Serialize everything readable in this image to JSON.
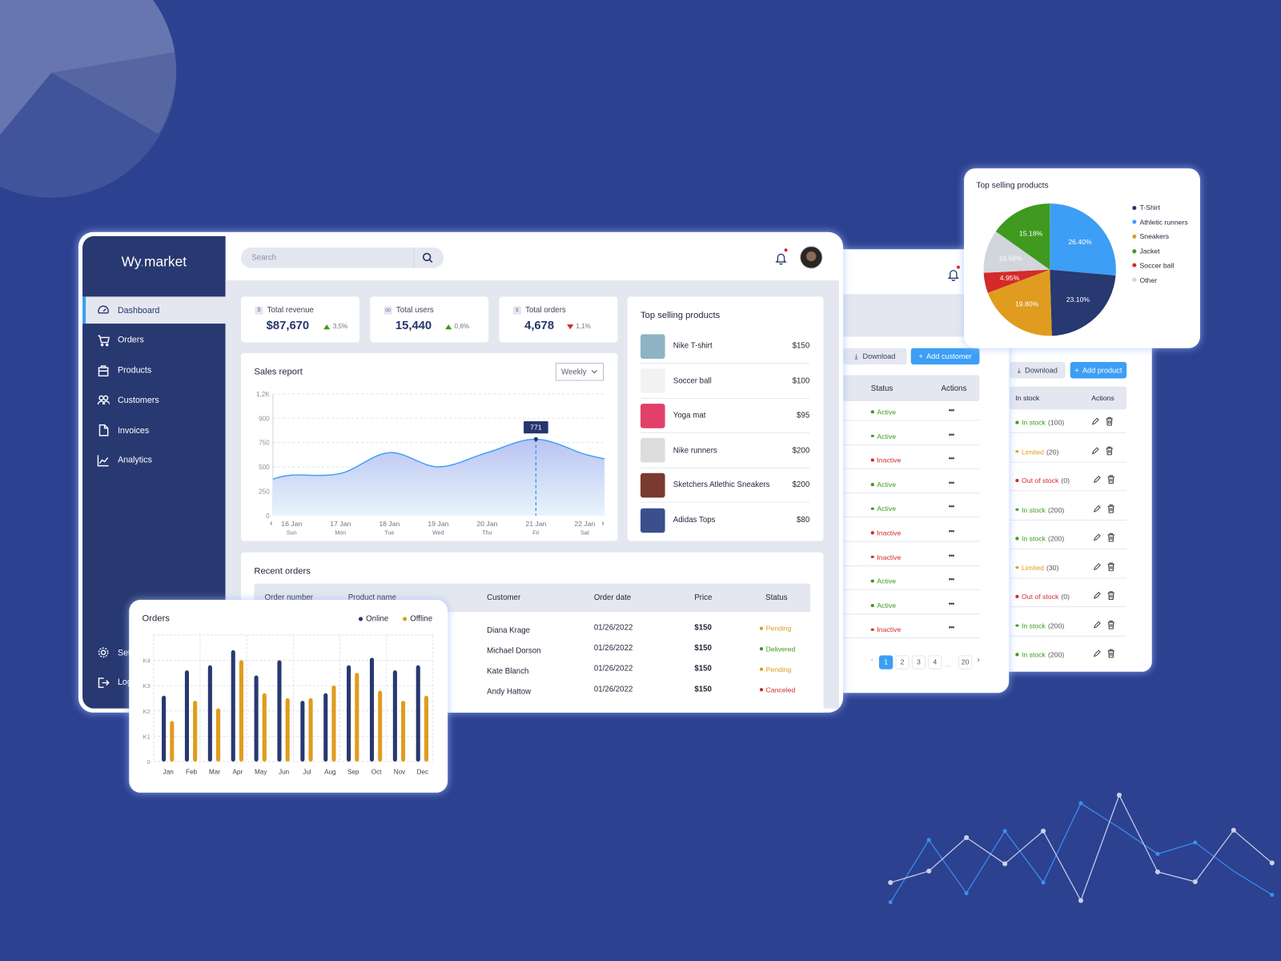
{
  "app": {
    "logo_prefix": "Wy",
    "logo_dot": ".",
    "logo_suffix": "market"
  },
  "colors": {
    "background": "#2c4190",
    "sidebar": "#283870",
    "accent": "#3d9ef5",
    "navy": "#27366e",
    "green": "#3f9a1f",
    "orange": "#e09c1e",
    "red": "#d42a2a",
    "panel_gray": "#e4e7f0"
  },
  "sidebar": {
    "items": [
      {
        "label": "Dashboard",
        "icon": "gauge-icon",
        "active": true
      },
      {
        "label": "Orders",
        "icon": "cart-icon"
      },
      {
        "label": "Products",
        "icon": "bag-icon"
      },
      {
        "label": "Customers",
        "icon": "users-icon"
      },
      {
        "label": "Invoices",
        "icon": "file-icon"
      },
      {
        "label": "Analytics",
        "icon": "chart-line-icon"
      }
    ],
    "bottom": [
      {
        "label": "Settings",
        "icon": "gear-icon"
      },
      {
        "label": "Log out",
        "icon": "logout-icon"
      }
    ]
  },
  "header": {
    "search_placeholder": "Search",
    "notifications_unread": true
  },
  "stats": [
    {
      "label": "Total revenue",
      "value": "$87,670",
      "change": "3,5%",
      "trend": "up",
      "icon": "dollar-icon"
    },
    {
      "label": "Total users",
      "value": "15,440",
      "change": "0,6%",
      "trend": "up",
      "icon": "users-icon"
    },
    {
      "label": "Total orders",
      "value": "4,678",
      "change": "1,1%",
      "trend": "down",
      "icon": "cart-icon"
    }
  ],
  "sales_report": {
    "period": "Weekly",
    "tooltip": "771"
  },
  "top_products": {
    "title": "Top selling products",
    "items": [
      {
        "name": "Nike T-shirt",
        "price": "$150",
        "thumb": "#8fb3c4"
      },
      {
        "name": "Soccer ball",
        "price": "$100",
        "thumb": "#f2f2f4"
      },
      {
        "name": "Yoga mat",
        "price": "$95",
        "thumb": "#e0406a"
      },
      {
        "name": "Nike runners",
        "price": "$200",
        "thumb": "#dcdcdc"
      },
      {
        "name": "Sketchers Atlethic Sneakers",
        "price": "$200",
        "thumb": "#7a3a30"
      },
      {
        "name": "Adidas Tops",
        "price": "$80",
        "thumb": "#3a4f8c"
      }
    ]
  },
  "recent_orders": {
    "title": "Recent orders",
    "columns": [
      "Order number",
      "Product name",
      "Customer",
      "Order date",
      "Price",
      "Status"
    ],
    "rows": [
      {
        "customer": "Diana Krage",
        "date": "01/26/2022",
        "price": "$150",
        "status": "Pending"
      },
      {
        "customer": "Michael Dorson",
        "date": "01/26/2022",
        "price": "$150",
        "status": "Delivered"
      },
      {
        "customer": "Kate Blanch",
        "date": "01/26/2022",
        "price": "$150",
        "status": "Pending"
      },
      {
        "customer": "Andy Hattow",
        "date": "01/26/2022",
        "price": "$150",
        "status": "Canceled"
      }
    ]
  },
  "customers_panel": {
    "download": "Download",
    "add": "Add customer",
    "columns": [
      "Status",
      "Actions"
    ],
    "rows": [
      "Active",
      "Active",
      "Inactive",
      "Active",
      "Active",
      "Inactive",
      "Inactive",
      "Active",
      "Active",
      "Inactive"
    ],
    "actions_glyph": "•••",
    "pagination": {
      "pages": [
        "1",
        "2",
        "3",
        "4"
      ],
      "ellipsis": "...",
      "last": "20",
      "current": "1"
    }
  },
  "products_panel": {
    "download": "Download",
    "add": "Add product",
    "columns": [
      "In stock",
      "Actions"
    ],
    "rows": [
      {
        "status": "In stock",
        "count": "(100)"
      },
      {
        "status": "Limited",
        "count": "(20)"
      },
      {
        "status": "Out of stock",
        "count": "(0)"
      },
      {
        "status": "In stock",
        "count": "(200)"
      },
      {
        "status": "In stock",
        "count": "(200)"
      },
      {
        "status": "Limited",
        "count": "(30)"
      },
      {
        "status": "Out of stock",
        "count": "(0)"
      },
      {
        "status": "In stock",
        "count": "(200)"
      },
      {
        "status": "In stock",
        "count": "(200)"
      }
    ]
  },
  "chart_data": [
    {
      "type": "area",
      "title": "Sales report",
      "categories": [
        "16 Jan",
        "17 Jan",
        "18 Jan",
        "19 Jan",
        "20 Jan",
        "21 Jan",
        "22 Jan"
      ],
      "weekdays": [
        "Sun",
        "Mon",
        "Tue",
        "Wed",
        "Thu",
        "Fri",
        "Sat"
      ],
      "values": [
        416,
        433,
        647,
        501,
        647,
        771,
        630
      ],
      "y_ticks": [
        0,
        250,
        500,
        750,
        900,
        1200
      ],
      "y_tick_labels": [
        "0",
        "250",
        "500",
        "750",
        "900",
        "1,2K"
      ],
      "highlight": {
        "category": "21 Jan",
        "value": 771
      },
      "grid": true,
      "color": "#3d9ef5"
    },
    {
      "type": "bar",
      "title": "Orders",
      "categories": [
        "Jan",
        "Feb",
        "Mar",
        "Apr",
        "May",
        "Jun",
        "Jul",
        "Aug",
        "Sep",
        "Oct",
        "Nov",
        "Dec"
      ],
      "series": [
        {
          "name": "Online",
          "color": "#283870",
          "values": [
            2.6,
            3.6,
            3.8,
            4.4,
            3.4,
            4.0,
            2.4,
            2.7,
            3.8,
            4.1,
            3.6,
            3.8
          ]
        },
        {
          "name": "Offline",
          "color": "#e09c1e",
          "values": [
            1.6,
            2.4,
            2.1,
            4.0,
            2.7,
            2.5,
            2.5,
            3.0,
            3.5,
            2.8,
            2.4,
            2.6
          ]
        }
      ],
      "y_tick_labels": [
        "0",
        "K1",
        "K2",
        "K3",
        "K4"
      ],
      "ylim": [
        0,
        5
      ],
      "grid": true,
      "legend": "top-right"
    },
    {
      "type": "pie",
      "title": "Top selling products",
      "slices": [
        {
          "label": "Athletic runners",
          "value": 26.4,
          "text": "26.40%",
          "color": "#3d9ef5"
        },
        {
          "label": "T-Shirt",
          "value": 23.1,
          "text": "23.10%",
          "color": "#283870"
        },
        {
          "label": "Sneakers",
          "value": 19.8,
          "text": "19.80%",
          "color": "#e09c1e"
        },
        {
          "label": "Soccer ball",
          "value": 4.95,
          "text": "4.95%",
          "color": "#d42a2a"
        },
        {
          "label": "Other",
          "value": 10.56,
          "text": "10.56%",
          "color": "#d1d5dc"
        },
        {
          "label": "Jacket",
          "value": 15.18,
          "text": "15.18%",
          "color": "#3f9a1f"
        }
      ],
      "legend_order": [
        "T-Shirt",
        "Athletic runners",
        "Sneakers",
        "Jacket",
        "Soccer ball",
        "Other"
      ],
      "legend": "right"
    }
  ]
}
